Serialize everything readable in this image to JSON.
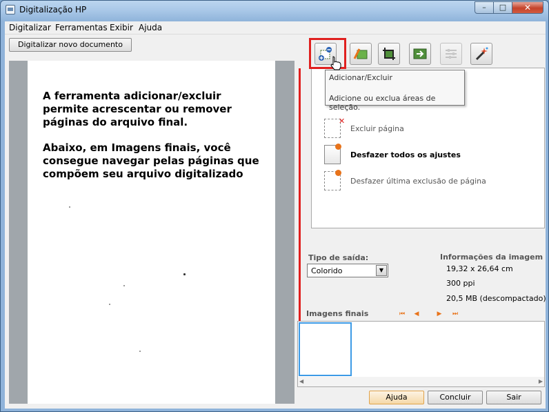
{
  "window": {
    "title": "Digitalização HP",
    "min_glyph": "–",
    "max_glyph": "□",
    "close_glyph": "✕"
  },
  "menu": [
    "Digitalizar",
    "Ferramentas",
    "Exibir",
    "Ajuda"
  ],
  "scan_button": "Digitalizar novo documento",
  "page": {
    "paragraph1": "A ferramenta adicionar/excluir permite acrescentar ou remover páginas do arquivo final.",
    "paragraph2": "Abaixo, em Imagens finais, você consegue navegar pelas páginas que compõem seu arquivo digitalizado"
  },
  "toolbar_icons": [
    "add-remove-pages-icon",
    "color-adjust-icon",
    "crop-icon",
    "export-icon",
    "sliders-icon",
    "magic-wand-icon"
  ],
  "tooltip": {
    "title": "Adicionar/Excluir",
    "description": "Adicione ou exclua áreas de seleção."
  },
  "tools_panel": {
    "items": [
      {
        "label": "Excluir página",
        "enabled": false
      },
      {
        "label": "Desfazer todos os ajustes",
        "enabled": true
      },
      {
        "label": "Desfazer última exclusão de página",
        "enabled": false
      }
    ]
  },
  "output": {
    "label": "Tipo de saída:",
    "selected": "Colorido"
  },
  "image_info": {
    "label": "Informações da imagem",
    "dimensions": "19,32 x 26,64 cm",
    "resolution": "300 ppi",
    "size": "20,5 MB (descompactado)"
  },
  "final_images": {
    "label": "Imagens finais"
  },
  "buttons": {
    "help": "Ajuda",
    "finish": "Concluir",
    "exit": "Sair"
  },
  "colors": {
    "highlight": "#e0201f",
    "accent": "#e8731a",
    "selection": "#3c9ae6"
  }
}
